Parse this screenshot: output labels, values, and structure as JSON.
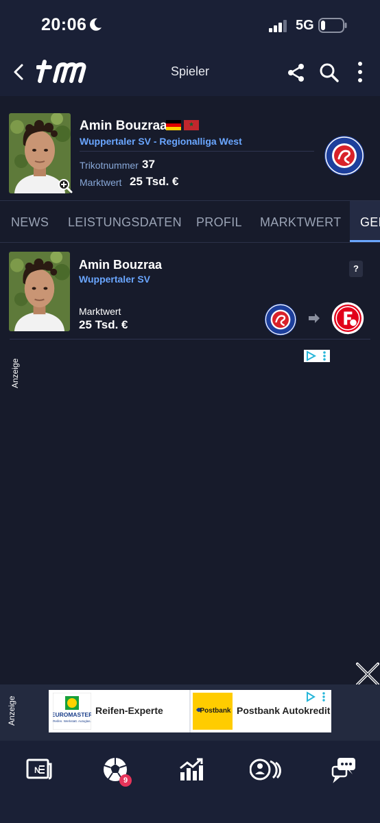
{
  "status": {
    "time": "20:06",
    "network": "5G"
  },
  "appbar": {
    "title": "Spieler"
  },
  "player": {
    "name": "Amin Bouzraa",
    "club_league": "Wuppertaler SV - Regionalliga West",
    "shirt_label": "Trikotnummer",
    "shirt_number": "37",
    "value_label": "Marktwert",
    "value": "25 Tsd. €"
  },
  "tabs": [
    {
      "label": "NEWS",
      "active": false
    },
    {
      "label": "LEISTUNGSDATEN",
      "active": false
    },
    {
      "label": "PROFIL",
      "active": false
    },
    {
      "label": "MARKTWERT",
      "active": false
    },
    {
      "label": "GERÜCHTE",
      "active": true
    }
  ],
  "transfer": {
    "name": "Amin Bouzraa",
    "club": "Wuppertaler SV",
    "help": "?",
    "value_label": "Marktwert",
    "value": "25 Tsd. €"
  },
  "ads": {
    "label": "Anzeige",
    "banner": [
      {
        "brand": "EUROMASTER",
        "tagline": "Reifen. Werkstatt. Autoglas.",
        "text": "Reifen-Experte"
      },
      {
        "brand": "Postbank",
        "text": "Postbank Autokredit"
      }
    ]
  },
  "nav": {
    "badge": "9"
  },
  "colors": {
    "background": "#171b2b",
    "bar": "#1a2036",
    "link": "#6aa6ff",
    "badge": "#e6345a",
    "postbank": "#ffcc00"
  }
}
